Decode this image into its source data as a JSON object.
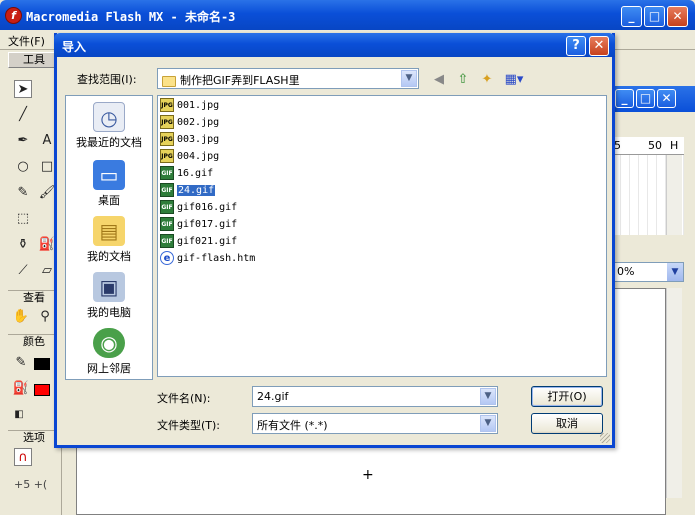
{
  "main_window": {
    "title": "Macromedia Flash MX - 未命名-3",
    "logo_letter": "f",
    "minimize": "_",
    "maximize": "□",
    "close": "✕",
    "menu_first": "文件(F)"
  },
  "toolbox": {
    "header": "工具",
    "sections": {
      "view": "查看",
      "colors": "颜色",
      "options": "选项"
    },
    "stroke_color": "#000000",
    "fill_color": "#ff0000"
  },
  "right_panel": {
    "ruler_5": "5",
    "ruler_50": "50",
    "ruler_unit": "H",
    "zoom_value": "0%"
  },
  "stage": {
    "crosshair": "+"
  },
  "dialog": {
    "title": "导入",
    "help_btn": "?",
    "close_btn": "✕",
    "look_in_label": "查找范围(I):",
    "look_in_value": "制作把GIF弄到FLASH里",
    "places": [
      {
        "label": "我最近的文档",
        "icon": "recent-documents-icon"
      },
      {
        "label": "桌面",
        "icon": "desktop-icon"
      },
      {
        "label": "我的文档",
        "icon": "my-documents-icon"
      },
      {
        "label": "我的电脑",
        "icon": "my-computer-icon"
      },
      {
        "label": "网上邻居",
        "icon": "network-places-icon"
      }
    ],
    "files": [
      {
        "name": "001.jpg",
        "type": "jpg"
      },
      {
        "name": "002.jpg",
        "type": "jpg"
      },
      {
        "name": "003.jpg",
        "type": "jpg"
      },
      {
        "name": "004.jpg",
        "type": "jpg"
      },
      {
        "name": "16.gif",
        "type": "gif"
      },
      {
        "name": "24.gif",
        "type": "gif",
        "selected": true
      },
      {
        "name": "gif016.gif",
        "type": "gif"
      },
      {
        "name": "gif017.gif",
        "type": "gif"
      },
      {
        "name": "gif021.gif",
        "type": "gif"
      },
      {
        "name": "gif-flash.htm",
        "type": "htm"
      }
    ],
    "filename_label": "文件名(N):",
    "filename_value": "24.gif",
    "filetype_label": "文件类型(T):",
    "filetype_value": "所有文件 (*.*)",
    "open_button": "打开(O)",
    "cancel_button": "取消"
  }
}
